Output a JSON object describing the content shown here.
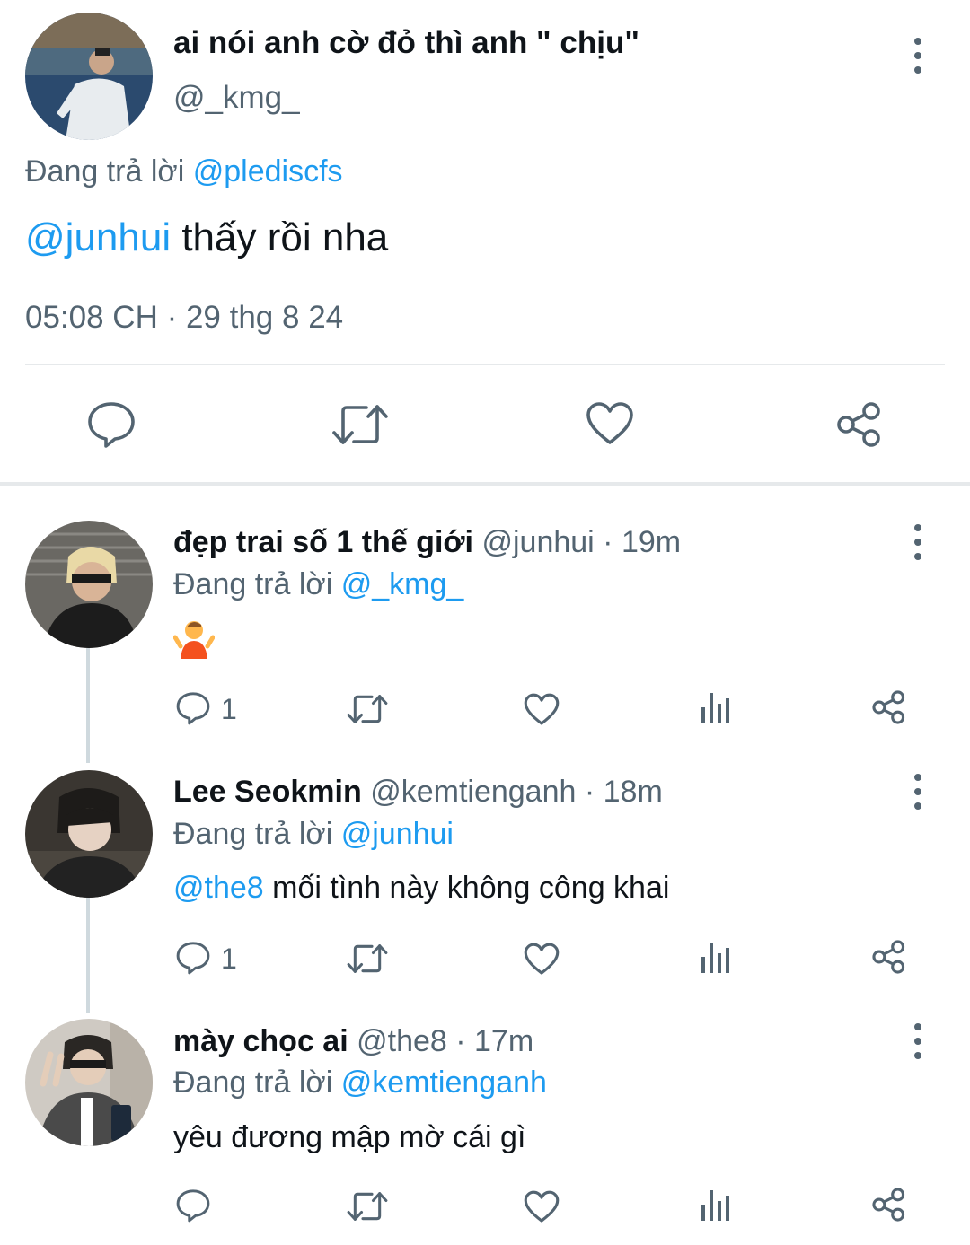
{
  "main_tweet": {
    "display_name": "ai nói anh cờ đỏ thì anh \" chịu\"",
    "handle": "@_kmg_",
    "replying_prefix": "Đang trả lời",
    "replying_to": "@pledisc​fs",
    "mention": "@junhui",
    "text": " thấy rồi nha",
    "timestamp": "05:08 CH · 29 thg 8 24",
    "actions": [
      "reply-icon",
      "retweet-icon",
      "like-icon",
      "share-icon"
    ]
  },
  "replies": [
    {
      "display_name": "đẹp trai số 1 thế giới",
      "handle_time": "@junhui · 19m",
      "replying_prefix": "Đang trả lời",
      "replying_to": "@_kmg_",
      "text": "🤷",
      "reply_count": "1"
    },
    {
      "display_name": "Lee Seokmin",
      "handle_time": "@kemtienganh · 18m",
      "replying_prefix": "Đang trả lời",
      "replying_to": "@junhui",
      "mention": "@the8",
      "text": " mối tình này không công khai",
      "reply_count": "1"
    },
    {
      "display_name": "mày chọc ai",
      "handle_time": "@the8 · 17m",
      "replying_prefix": "Đang trả lời",
      "replying_to": "@kemtienganh",
      "text": "yêu đương mập mờ cái gì"
    }
  ],
  "colors": {
    "link": "#1d9bf0",
    "secondary": "#536471",
    "divider": "#e6e9eb"
  }
}
